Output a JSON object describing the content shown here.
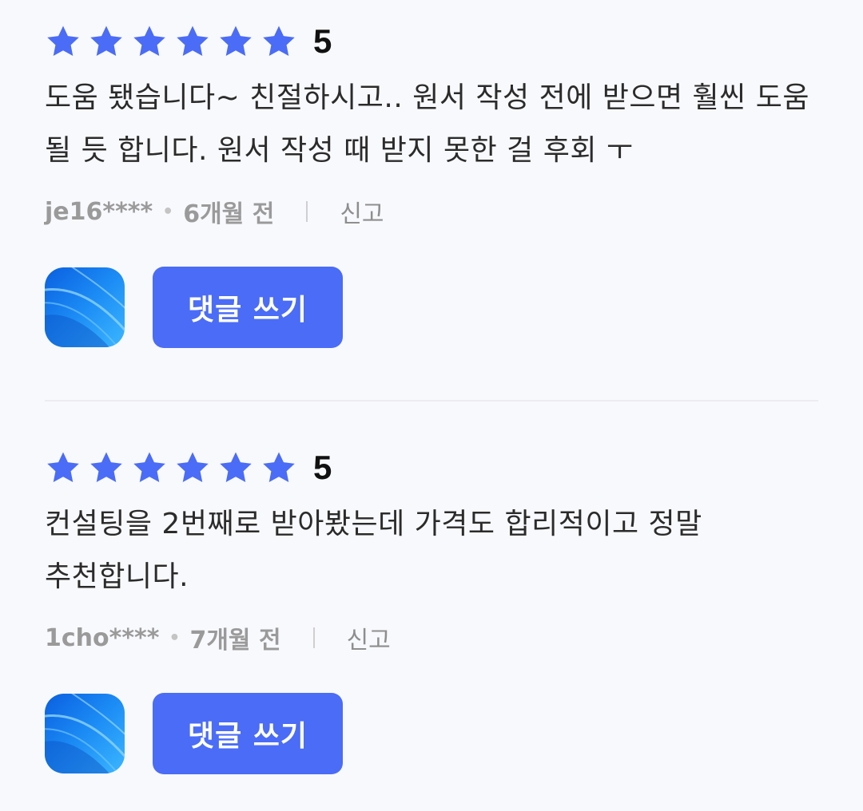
{
  "colors": {
    "star": "#4a6cf7",
    "button_bg": "#4a6cf7",
    "button_text": "#ffffff",
    "meta_text": "#9a9a9a",
    "background": "#f8f9fd"
  },
  "reviews": [
    {
      "stars": 6,
      "rating": "5",
      "text": "도움 됐습니다~ 친절하시고.. 원서 작성 전에 받으면 훨씬 도움 될 듯 합니다. 원서 작성 때 받지 못한 걸 후회 ㅜ",
      "author": "je16****",
      "date": "6개월 전",
      "report_label": "신고",
      "avatar_icon": "app-avatar-icon",
      "comment_button_label": "댓글 쓰기"
    },
    {
      "stars": 6,
      "rating": "5",
      "text": "컨설팅을 2번째로 받아봤는데 가격도 합리적이고 정말 추천합니다.",
      "author": "1cho****",
      "date": "7개월 전",
      "report_label": "신고",
      "avatar_icon": "app-avatar-icon",
      "comment_button_label": "댓글 쓰기"
    }
  ]
}
